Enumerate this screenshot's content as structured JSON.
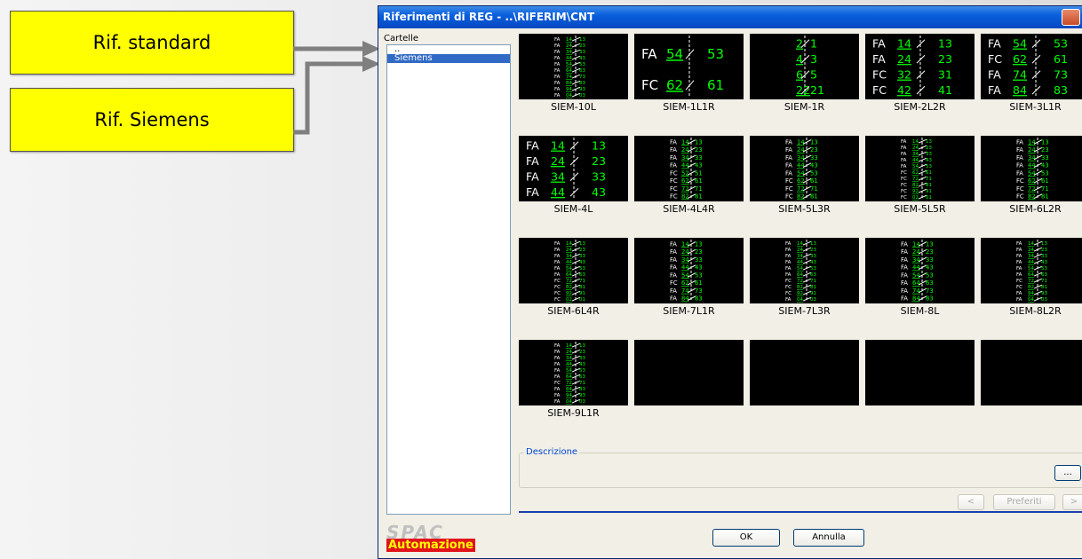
{
  "callouts": {
    "standard": "Rif. standard",
    "siemens": "Rif. Siemens"
  },
  "dialog": {
    "title": "Riferimenti di REG - ..\\RIFERIM\\CNT",
    "folders_label": "Cartelle",
    "folders": [
      {
        "label": "..",
        "selected": false
      },
      {
        "label": "Siemens",
        "selected": true
      }
    ],
    "tiles": [
      {
        "label": "SIEM-10L",
        "rows": [
          {
            "p": "FA",
            "l": "14",
            "r": "13"
          },
          {
            "p": "FA",
            "l": "24",
            "r": "23"
          },
          {
            "p": "FA",
            "l": "34",
            "r": "33"
          },
          {
            "p": "FA",
            "l": "44",
            "r": "43"
          },
          {
            "p": "FA",
            "l": "54",
            "r": "53"
          },
          {
            "p": "FA",
            "l": "64",
            "r": "63"
          },
          {
            "p": "FA",
            "l": "74",
            "r": "73"
          },
          {
            "p": "FA",
            "l": "84",
            "r": "83"
          },
          {
            "p": "FA",
            "l": "94",
            "r": "93"
          },
          {
            "p": "FA",
            "l": "04",
            "r": "03"
          }
        ]
      },
      {
        "label": "SIEM-1L1R",
        "rows": [
          {
            "p": "FA",
            "l": "54",
            "r": "53"
          },
          {
            "p": "FC",
            "l": "62",
            "r": "61"
          }
        ]
      },
      {
        "label": "SIEM-1R",
        "rows": [
          {
            "p": "",
            "l": "2",
            "r": "1"
          },
          {
            "p": "",
            "l": "4",
            "r": "3"
          },
          {
            "p": "",
            "l": "6",
            "r": "5"
          },
          {
            "p": "",
            "l": "22",
            "r": "21"
          }
        ]
      },
      {
        "label": "SIEM-2L2R",
        "rows": [
          {
            "p": "FA",
            "l": "14",
            "r": "13"
          },
          {
            "p": "FA",
            "l": "24",
            "r": "23"
          },
          {
            "p": "FC",
            "l": "32",
            "r": "31"
          },
          {
            "p": "FC",
            "l": "42",
            "r": "41"
          }
        ]
      },
      {
        "label": "SIEM-3L1R",
        "rows": [
          {
            "p": "FA",
            "l": "54",
            "r": "53"
          },
          {
            "p": "FC",
            "l": "62",
            "r": "61"
          },
          {
            "p": "FA",
            "l": "74",
            "r": "73"
          },
          {
            "p": "FA",
            "l": "84",
            "r": "83"
          }
        ]
      },
      {
        "label": "SIEM-4L",
        "rows": [
          {
            "p": "FA",
            "l": "14",
            "r": "13"
          },
          {
            "p": "FA",
            "l": "24",
            "r": "23"
          },
          {
            "p": "FA",
            "l": "34",
            "r": "33"
          },
          {
            "p": "FA",
            "l": "44",
            "r": "43"
          }
        ]
      },
      {
        "label": "SIEM-4L4R",
        "rows": [
          {
            "p": "FA",
            "l": "14",
            "r": "13"
          },
          {
            "p": "FA",
            "l": "24",
            "r": "23"
          },
          {
            "p": "FA",
            "l": "34",
            "r": "33"
          },
          {
            "p": "FA",
            "l": "44",
            "r": "43"
          },
          {
            "p": "FC",
            "l": "52",
            "r": "51"
          },
          {
            "p": "FC",
            "l": "62",
            "r": "61"
          },
          {
            "p": "FC",
            "l": "72",
            "r": "71"
          },
          {
            "p": "FC",
            "l": "82",
            "r": "81"
          }
        ]
      },
      {
        "label": "SIEM-5L3R",
        "rows": [
          {
            "p": "FA",
            "l": "14",
            "r": "13"
          },
          {
            "p": "FA",
            "l": "24",
            "r": "23"
          },
          {
            "p": "FA",
            "l": "34",
            "r": "33"
          },
          {
            "p": "FA",
            "l": "44",
            "r": "43"
          },
          {
            "p": "FA",
            "l": "54",
            "r": "53"
          },
          {
            "p": "FC",
            "l": "62",
            "r": "61"
          },
          {
            "p": "FC",
            "l": "72",
            "r": "71"
          },
          {
            "p": "FC",
            "l": "82",
            "r": "81"
          }
        ]
      },
      {
        "label": "SIEM-5L5R",
        "rows": [
          {
            "p": "FA",
            "l": "14",
            "r": "13"
          },
          {
            "p": "FA",
            "l": "24",
            "r": "23"
          },
          {
            "p": "FA",
            "l": "34",
            "r": "33"
          },
          {
            "p": "FA",
            "l": "44",
            "r": "43"
          },
          {
            "p": "FA",
            "l": "54",
            "r": "53"
          },
          {
            "p": "FC",
            "l": "62",
            "r": "61"
          },
          {
            "p": "FC",
            "l": "72",
            "r": "71"
          },
          {
            "p": "FC",
            "l": "82",
            "r": "81"
          },
          {
            "p": "FC",
            "l": "92",
            "r": "91"
          },
          {
            "p": "FC",
            "l": "02",
            "r": "01"
          }
        ]
      },
      {
        "label": "SIEM-6L2R",
        "rows": [
          {
            "p": "FA",
            "l": "14",
            "r": "13"
          },
          {
            "p": "FA",
            "l": "24",
            "r": "23"
          },
          {
            "p": "FA",
            "l": "34",
            "r": "33"
          },
          {
            "p": "FA",
            "l": "44",
            "r": "43"
          },
          {
            "p": "FA",
            "l": "54",
            "r": "53"
          },
          {
            "p": "FC",
            "l": "62",
            "r": "61"
          },
          {
            "p": "FC",
            "l": "72",
            "r": "71"
          },
          {
            "p": "FC",
            "l": "82",
            "r": "81"
          }
        ]
      },
      {
        "label": "SIEM-6L4R",
        "rows": [
          {
            "p": "FA",
            "l": "14",
            "r": "13"
          },
          {
            "p": "FA",
            "l": "24",
            "r": "23"
          },
          {
            "p": "FA",
            "l": "34",
            "r": "33"
          },
          {
            "p": "FA",
            "l": "44",
            "r": "43"
          },
          {
            "p": "FA",
            "l": "54",
            "r": "53"
          },
          {
            "p": "FA",
            "l": "64",
            "r": "63"
          },
          {
            "p": "FC",
            "l": "72",
            "r": "71"
          },
          {
            "p": "FC",
            "l": "82",
            "r": "81"
          },
          {
            "p": "FC",
            "l": "92",
            "r": "91"
          },
          {
            "p": "FC",
            "l": "02",
            "r": "01"
          }
        ]
      },
      {
        "label": "SIEM-7L1R",
        "rows": [
          {
            "p": "FA",
            "l": "14",
            "r": "13"
          },
          {
            "p": "FA",
            "l": "24",
            "r": "23"
          },
          {
            "p": "FA",
            "l": "34",
            "r": "33"
          },
          {
            "p": "FA",
            "l": "44",
            "r": "43"
          },
          {
            "p": "FA",
            "l": "54",
            "r": "53"
          },
          {
            "p": "FC",
            "l": "62",
            "r": "61"
          },
          {
            "p": "FA",
            "l": "74",
            "r": "73"
          },
          {
            "p": "FA",
            "l": "84",
            "r": "83"
          }
        ]
      },
      {
        "label": "SIEM-7L3R",
        "rows": [
          {
            "p": "FA",
            "l": "14",
            "r": "13"
          },
          {
            "p": "FA",
            "l": "24",
            "r": "23"
          },
          {
            "p": "FA",
            "l": "34",
            "r": "33"
          },
          {
            "p": "FA",
            "l": "44",
            "r": "43"
          },
          {
            "p": "FA",
            "l": "54",
            "r": "53"
          },
          {
            "p": "FA",
            "l": "64",
            "r": "63"
          },
          {
            "p": "FC",
            "l": "72",
            "r": "71"
          },
          {
            "p": "FC",
            "l": "82",
            "r": "81"
          },
          {
            "p": "FC",
            "l": "92",
            "r": "91"
          },
          {
            "p": "FA",
            "l": "04",
            "r": "03"
          }
        ]
      },
      {
        "label": "SIEM-8L",
        "rows": [
          {
            "p": "FA",
            "l": "14",
            "r": "13"
          },
          {
            "p": "FA",
            "l": "24",
            "r": "23"
          },
          {
            "p": "FA",
            "l": "34",
            "r": "33"
          },
          {
            "p": "FA",
            "l": "44",
            "r": "43"
          },
          {
            "p": "FA",
            "l": "54",
            "r": "53"
          },
          {
            "p": "FA",
            "l": "64",
            "r": "63"
          },
          {
            "p": "FA",
            "l": "74",
            "r": "73"
          },
          {
            "p": "FA",
            "l": "84",
            "r": "83"
          }
        ]
      },
      {
        "label": "SIEM-8L2R",
        "rows": [
          {
            "p": "FA",
            "l": "14",
            "r": "13"
          },
          {
            "p": "FA",
            "l": "24",
            "r": "23"
          },
          {
            "p": "FA",
            "l": "34",
            "r": "33"
          },
          {
            "p": "FA",
            "l": "44",
            "r": "43"
          },
          {
            "p": "FA",
            "l": "54",
            "r": "53"
          },
          {
            "p": "FA",
            "l": "64",
            "r": "63"
          },
          {
            "p": "FC",
            "l": "72",
            "r": "71"
          },
          {
            "p": "FC",
            "l": "82",
            "r": "81"
          },
          {
            "p": "FA",
            "l": "94",
            "r": "93"
          },
          {
            "p": "FA",
            "l": "04",
            "r": "03"
          }
        ]
      },
      {
        "label": "SIEM-9L1R",
        "rows": [
          {
            "p": "FA",
            "l": "14",
            "r": "13"
          },
          {
            "p": "FA",
            "l": "24",
            "r": "23"
          },
          {
            "p": "FA",
            "l": "34",
            "r": "33"
          },
          {
            "p": "FA",
            "l": "44",
            "r": "43"
          },
          {
            "p": "FA",
            "l": "54",
            "r": "53"
          },
          {
            "p": "FA",
            "l": "64",
            "r": "63"
          },
          {
            "p": "FC",
            "l": "72",
            "r": "71"
          },
          {
            "p": "FA",
            "l": "84",
            "r": "83"
          },
          {
            "p": "FA",
            "l": "94",
            "r": "93"
          },
          {
            "p": "FA",
            "l": "04",
            "r": "03"
          }
        ]
      },
      {
        "label": "",
        "rows": []
      },
      {
        "label": "",
        "rows": []
      },
      {
        "label": "",
        "rows": []
      },
      {
        "label": "",
        "rows": []
      }
    ],
    "description_label": "Descrizione",
    "browse_label": "...",
    "prev_label": "<",
    "favorites_label": "Preferiti",
    "next_label": ">",
    "ok_label": "OK",
    "cancel_label": "Annulla",
    "logo_text": "SPAC",
    "logo_subtext": "Automazione"
  },
  "colors": {
    "callout_fill": "#ffff00",
    "connector": "#7f7f7f",
    "titlebar": "#0a5fdc",
    "selection": "#316ac5",
    "thumb_bg": "#000000",
    "schematic_text": "#00ff00",
    "schematic_prefix": "#ffffff",
    "logo_bar": "#e2141b"
  }
}
